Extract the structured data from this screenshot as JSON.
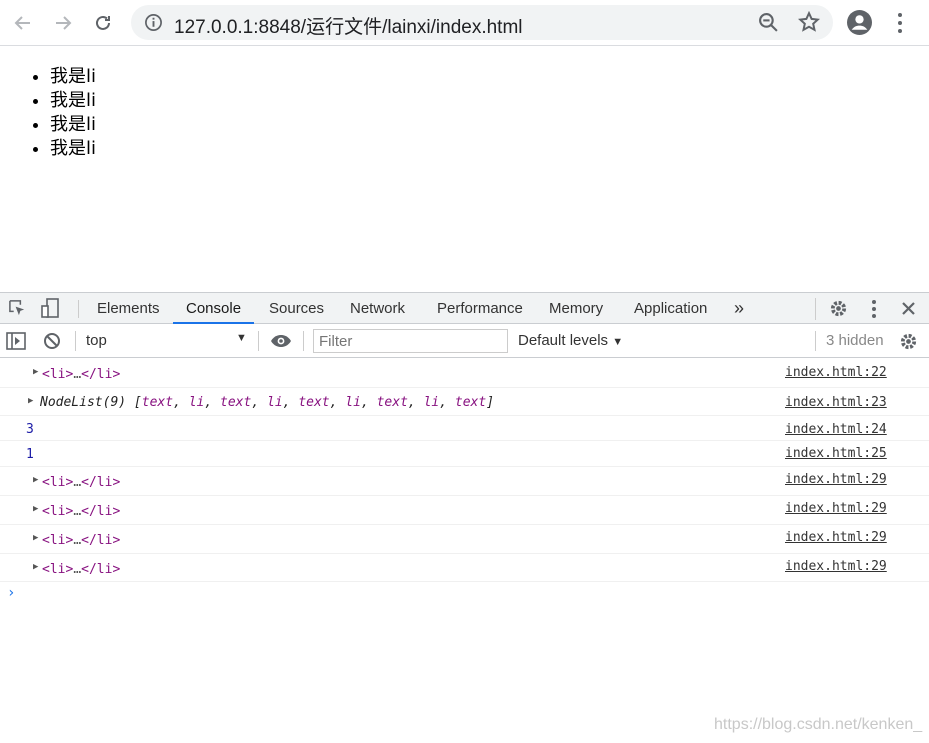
{
  "browser": {
    "url": "127.0.0.1:8848/运行文件/lainxi/index.html"
  },
  "page": {
    "list_items": [
      "我是li",
      "我是li",
      "我是li",
      "我是li"
    ]
  },
  "devtools": {
    "tabs": [
      "Elements",
      "Console",
      "Sources",
      "Network",
      "Performance",
      "Memory",
      "Application"
    ],
    "more_tabs": "»",
    "active_tab": "Console",
    "context": "top",
    "filter_placeholder": "Filter",
    "levels": "Default levels",
    "hidden": "3 hidden"
  },
  "console": {
    "li_open": "<li>",
    "ellipsis": "…",
    "li_close": "</li>",
    "nodelist_prefix": "NodeList(9) [",
    "nodelist_items": [
      "text",
      "li",
      "text",
      "li",
      "text",
      "li",
      "text",
      "li",
      "text"
    ],
    "nodelist_suffix": "]",
    "num1": "3",
    "num2": "1",
    "sources": [
      "index.html:22",
      "index.html:23",
      "index.html:24",
      "index.html:25",
      "index.html:29",
      "index.html:29",
      "index.html:29",
      "index.html:29"
    ],
    "prompt": "›"
  },
  "watermark": "https://blog.csdn.net/kenken_"
}
